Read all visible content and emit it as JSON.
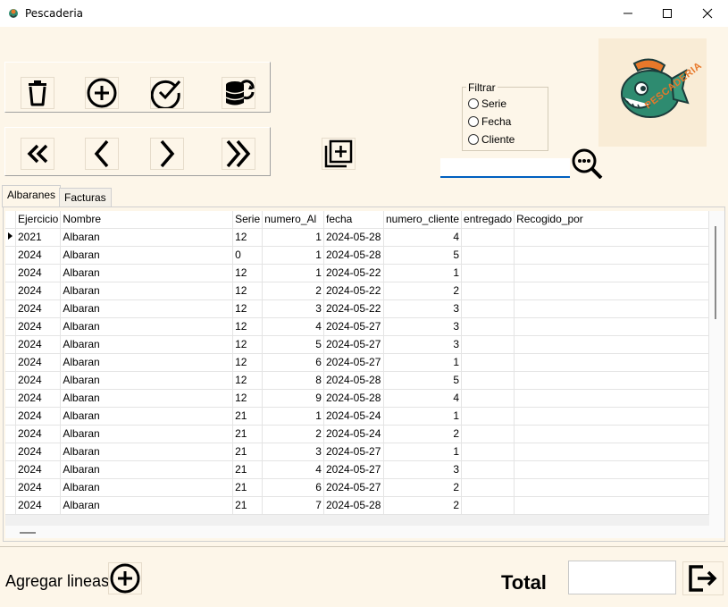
{
  "window": {
    "title": "Pescaderia"
  },
  "toolbar": {
    "delete_icon": "trash-icon",
    "add_icon": "plus-circle-icon",
    "confirm_icon": "check-circle-icon",
    "sync_icon": "database-sync-icon",
    "first_icon": "double-chevron-left-icon",
    "prev_icon": "chevron-left-icon",
    "next_icon": "chevron-right-icon",
    "last_icon": "double-chevron-right-icon",
    "new_copy_icon": "add-document-icon"
  },
  "filter": {
    "legend": "Filtrar",
    "options": [
      "Serie",
      "Fecha",
      "Cliente"
    ]
  },
  "search": {
    "value": "",
    "icon": "search-more-icon"
  },
  "logo": {
    "text": "PESCADERIA",
    "icon": "fish-mascot-logo"
  },
  "tabs": [
    "Albaranes",
    "Facturas"
  ],
  "grid": {
    "columns": [
      "Ejercicio",
      "Nombre",
      "Serie",
      "numero_Al",
      "fecha",
      "numero_cliente",
      "entregado",
      "Recogido_por"
    ],
    "rows": [
      [
        "2021",
        "Albaran",
        "12",
        "1",
        "2024-05-28",
        "4",
        "",
        ""
      ],
      [
        "2024",
        "Albaran",
        "0",
        "1",
        "2024-05-28",
        "5",
        "",
        ""
      ],
      [
        "2024",
        "Albaran",
        "12",
        "1",
        "2024-05-22",
        "1",
        "",
        ""
      ],
      [
        "2024",
        "Albaran",
        "12",
        "2",
        "2024-05-22",
        "2",
        "",
        ""
      ],
      [
        "2024",
        "Albaran",
        "12",
        "3",
        "2024-05-22",
        "3",
        "",
        ""
      ],
      [
        "2024",
        "Albaran",
        "12",
        "4",
        "2024-05-27",
        "3",
        "",
        ""
      ],
      [
        "2024",
        "Albaran",
        "12",
        "5",
        "2024-05-27",
        "3",
        "",
        ""
      ],
      [
        "2024",
        "Albaran",
        "12",
        "6",
        "2024-05-27",
        "1",
        "",
        ""
      ],
      [
        "2024",
        "Albaran",
        "12",
        "8",
        "2024-05-28",
        "5",
        "",
        ""
      ],
      [
        "2024",
        "Albaran",
        "12",
        "9",
        "2024-05-28",
        "4",
        "",
        ""
      ],
      [
        "2024",
        "Albaran",
        "21",
        "1",
        "2024-05-24",
        "1",
        "",
        ""
      ],
      [
        "2024",
        "Albaran",
        "21",
        "2",
        "2024-05-24",
        "2",
        "",
        ""
      ],
      [
        "2024",
        "Albaran",
        "21",
        "3",
        "2024-05-27",
        "1",
        "",
        ""
      ],
      [
        "2024",
        "Albaran",
        "21",
        "4",
        "2024-05-27",
        "3",
        "",
        ""
      ],
      [
        "2024",
        "Albaran",
        "21",
        "6",
        "2024-05-27",
        "2",
        "",
        ""
      ],
      [
        "2024",
        "Albaran",
        "21",
        "7",
        "2024-05-28",
        "2",
        "",
        ""
      ]
    ]
  },
  "footer": {
    "agregar_label": "Agregar lineas",
    "total_label": "Total",
    "total_value": "",
    "exit_icon": "exit-icon"
  },
  "colors": {
    "background": "#fdf6e9",
    "accent": "#0060c0",
    "logo_orange": "#e8782a",
    "logo_green": "#2e8b70"
  }
}
